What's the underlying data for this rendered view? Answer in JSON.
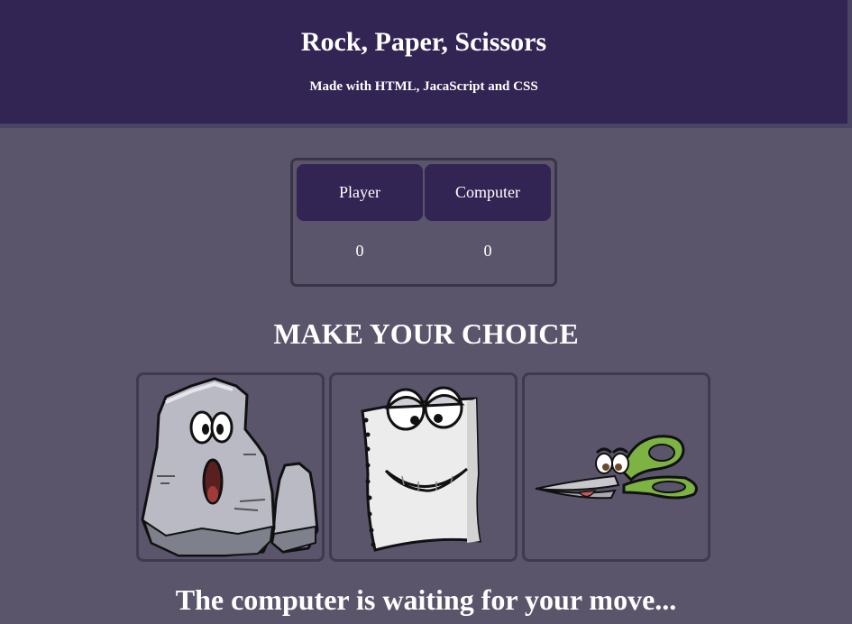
{
  "header": {
    "title": "Rock, Paper, Scissors",
    "subtitle": "Made with HTML, JacaScript and CSS"
  },
  "scoreboard": {
    "player_label": "Player",
    "computer_label": "Computer",
    "player_score": "0",
    "computer_score": "0"
  },
  "choices": {
    "title": "MAKE YOUR CHOICE",
    "options": [
      {
        "name": "rock",
        "icon": "rock-icon"
      },
      {
        "name": "paper",
        "icon": "paper-icon"
      },
      {
        "name": "scissors",
        "icon": "scissors-icon"
      }
    ]
  },
  "status": "The computer is waiting for your move...",
  "colors": {
    "header_bg": "#322453",
    "page_bg": "#5b556c",
    "card_border": "#3f3a4d",
    "text": "#ffffff",
    "scissors_handle": "#7cb342"
  }
}
